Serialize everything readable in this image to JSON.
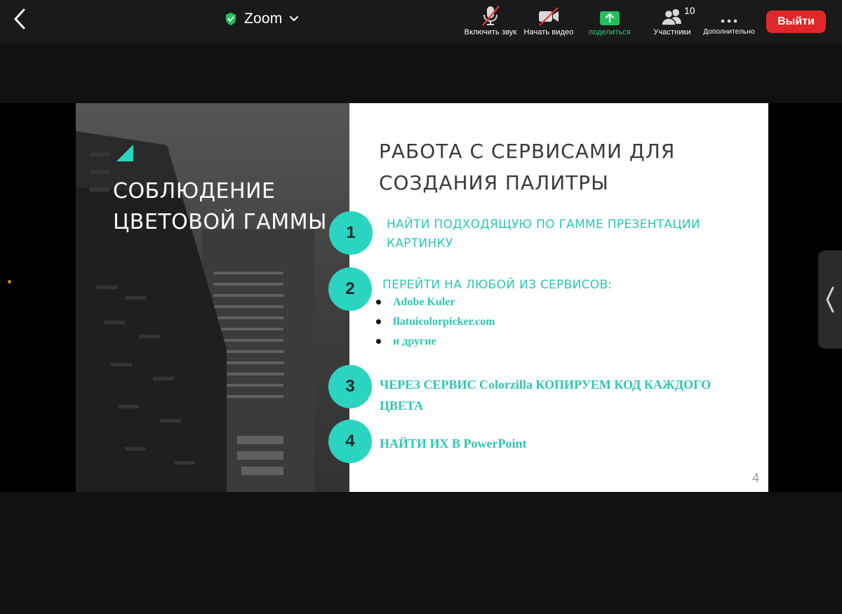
{
  "meeting": {
    "title": "Zoom"
  },
  "toolbar": {
    "audio_label": "Включить звук",
    "video_label": "Начать видео",
    "share_label": "поделиться",
    "participants_label": "Участники",
    "participants_count": "10",
    "more_label": "Дополнительно",
    "leave_label": "Выйти"
  },
  "colors": {
    "accent_teal": "#2bd4c0",
    "leave_red": "#e02828",
    "share_green": "#2fd06a"
  },
  "icons": [
    "back-chevron-icon",
    "shield-check-icon",
    "chevron-down-icon",
    "mic-muted-icon",
    "video-off-icon",
    "share-arrow-icon",
    "participants-icon",
    "more-dots-icon",
    "chevron-left-icon"
  ],
  "slide": {
    "left_title": [
      "СОБЛЮДЕНИЕ",
      "ЦВЕТОВОЙ ГАММЫ"
    ],
    "heading": [
      "РАБОТА С СЕРВИСАМИ ДЛЯ",
      "СОЗДАНИЯ ПАЛИТРЫ"
    ],
    "steps": [
      {
        "number": "1",
        "lines": [
          "НАЙТИ ПОДХОДЯЩУЮ ПО ГАММЕ ПРЕЗЕНТАЦИИ",
          "КАРТИНКУ"
        ]
      },
      {
        "number": "2",
        "lines": [
          "ПЕРЕЙТИ НА ЛЮБОЙ ИЗ СЕРВИСОВ:"
        ],
        "bullets": [
          "Adobe Kuler",
          "flatuicolorpicker.com",
          "и другие"
        ]
      },
      {
        "number": "3",
        "lines": [
          "ЧЕРЕЗ СЕРВИС Colorzilla КОПИРУЕМ КОД КАЖДОГО",
          "ЦВЕТА"
        ]
      },
      {
        "number": "4",
        "lines": [
          "НАЙТИ ИХ В PowerPoint"
        ]
      }
    ],
    "page_number": "4"
  }
}
